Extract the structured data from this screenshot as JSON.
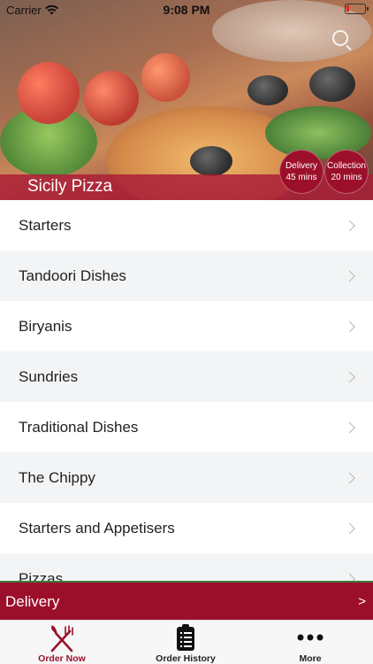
{
  "status_bar": {
    "carrier": "Carrier",
    "time": "9:08 PM",
    "battery_level": 0.15,
    "battery_color": "#e0231b"
  },
  "header": {
    "restaurant_name": "Sicily Pizza",
    "delivery_badge": {
      "line1": "Delivery",
      "line2": "45 mins"
    },
    "collection_badge": {
      "line1": "Collection",
      "line2": "20 mins"
    },
    "search_icon": "search-icon"
  },
  "menu": {
    "items": [
      {
        "label": "Starters"
      },
      {
        "label": "Tandoori Dishes"
      },
      {
        "label": "Biryanis"
      },
      {
        "label": "Sundries"
      },
      {
        "label": "Traditional Dishes"
      },
      {
        "label": "The Chippy"
      },
      {
        "label": "Starters and Appetisers"
      },
      {
        "label": "Pizzas"
      }
    ]
  },
  "delivery_bar": {
    "label": "Delivery",
    "arrow": ">"
  },
  "tab_bar": {
    "tabs": [
      {
        "label": "Order Now",
        "icon": "fork-knife-icon"
      },
      {
        "label": "Order History",
        "icon": "clipboard-icon"
      },
      {
        "label": "More",
        "icon": "more-dots-icon"
      }
    ]
  },
  "colors": {
    "accent": "#9c0f2b",
    "list_alt": "#f3f4f6"
  }
}
